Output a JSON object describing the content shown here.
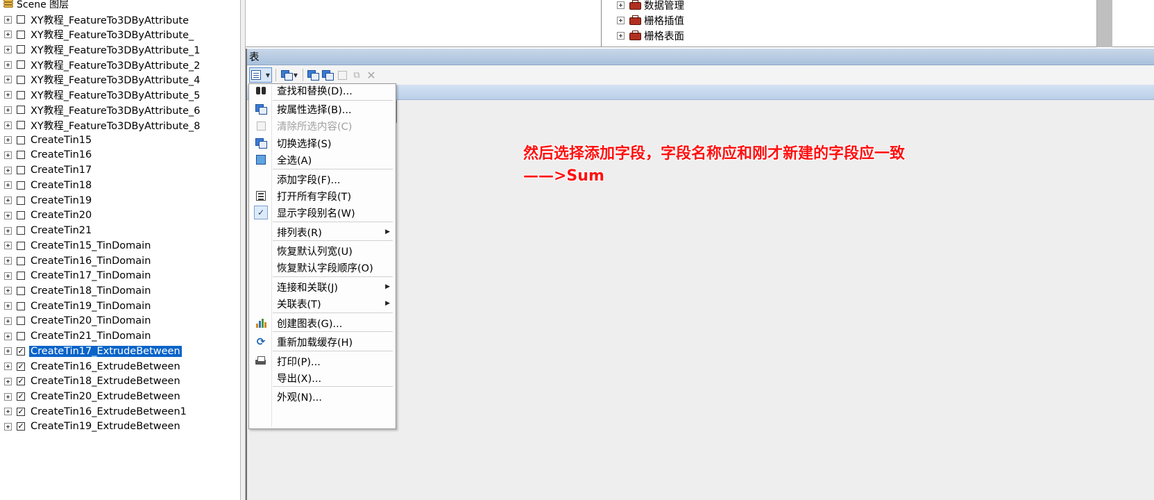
{
  "layer_tree": {
    "header": "Scene 图层",
    "items": [
      {
        "label": "XY教程_FeatureTo3DByAttribute",
        "checked": false,
        "selected": false
      },
      {
        "label": "XY教程_FeatureTo3DByAttribute_",
        "checked": false,
        "selected": false
      },
      {
        "label": "XY教程_FeatureTo3DByAttribute_1",
        "checked": false,
        "selected": false
      },
      {
        "label": "XY教程_FeatureTo3DByAttribute_2",
        "checked": false,
        "selected": false
      },
      {
        "label": "XY教程_FeatureTo3DByAttribute_4",
        "checked": false,
        "selected": false
      },
      {
        "label": "XY教程_FeatureTo3DByAttribute_5",
        "checked": false,
        "selected": false
      },
      {
        "label": "XY教程_FeatureTo3DByAttribute_6",
        "checked": false,
        "selected": false
      },
      {
        "label": "XY教程_FeatureTo3DByAttribute_8",
        "checked": false,
        "selected": false
      },
      {
        "label": "CreateTin15",
        "checked": false,
        "selected": false
      },
      {
        "label": "CreateTin16",
        "checked": false,
        "selected": false
      },
      {
        "label": "CreateTin17",
        "checked": false,
        "selected": false
      },
      {
        "label": "CreateTin18",
        "checked": false,
        "selected": false
      },
      {
        "label": "CreateTin19",
        "checked": false,
        "selected": false
      },
      {
        "label": "CreateTin20",
        "checked": false,
        "selected": false
      },
      {
        "label": "CreateTin21",
        "checked": false,
        "selected": false
      },
      {
        "label": "CreateTin15_TinDomain",
        "checked": false,
        "selected": false
      },
      {
        "label": "CreateTin16_TinDomain",
        "checked": false,
        "selected": false
      },
      {
        "label": "CreateTin17_TinDomain",
        "checked": false,
        "selected": false
      },
      {
        "label": "CreateTin18_TinDomain",
        "checked": false,
        "selected": false
      },
      {
        "label": "CreateTin19_TinDomain",
        "checked": false,
        "selected": false
      },
      {
        "label": "CreateTin20_TinDomain",
        "checked": false,
        "selected": false
      },
      {
        "label": "CreateTin21_TinDomain",
        "checked": false,
        "selected": false
      },
      {
        "label": "CreateTin17_ExtrudeBetween",
        "checked": true,
        "selected": true
      },
      {
        "label": "CreateTin16_ExtrudeBetween",
        "checked": true,
        "selected": false
      },
      {
        "label": "CreateTin18_ExtrudeBetween",
        "checked": true,
        "selected": false
      },
      {
        "label": "CreateTin20_ExtrudeBetween",
        "checked": true,
        "selected": false
      },
      {
        "label": "CreateTin16_ExtrudeBetween1",
        "checked": true,
        "selected": false
      },
      {
        "label": "CreateTin19_ExtrudeBetween",
        "checked": true,
        "selected": false
      }
    ]
  },
  "catalog": {
    "items": [
      {
        "label": "数据管理"
      },
      {
        "label": "栅格插值"
      },
      {
        "label": "栅格表面"
      }
    ]
  },
  "table_window": {
    "title": "表"
  },
  "menu": {
    "items": [
      {
        "label": "查找和替换(D)...",
        "icon": "binoculars-icon",
        "disabled": false,
        "submenu": false
      },
      {
        "label": "按属性选择(B)...",
        "icon": "select-by-attributes-icon",
        "disabled": false,
        "submenu": false
      },
      {
        "label": "清除所选内容(C)",
        "icon": "clear-selection-icon",
        "disabled": true,
        "submenu": false
      },
      {
        "label": "切换选择(S)",
        "icon": "switch-selection-icon",
        "disabled": false,
        "submenu": false
      },
      {
        "label": "全选(A)",
        "icon": "select-all-icon",
        "disabled": false,
        "submenu": false
      },
      {
        "label": "添加字段(F)...",
        "icon": "",
        "disabled": false,
        "submenu": false
      },
      {
        "label": "打开所有字段(T)",
        "icon": "fields-icon",
        "disabled": false,
        "submenu": false
      },
      {
        "label": "显示字段别名(W)",
        "icon": "check-icon",
        "disabled": false,
        "submenu": false
      },
      {
        "label": "排列表(R)",
        "icon": "",
        "disabled": false,
        "submenu": true
      },
      {
        "label": "恢复默认列宽(U)",
        "icon": "",
        "disabled": false,
        "submenu": false
      },
      {
        "label": "恢复默认字段顺序(O)",
        "icon": "",
        "disabled": false,
        "submenu": false
      },
      {
        "label": "连接和关联(J)",
        "icon": "",
        "disabled": false,
        "submenu": true
      },
      {
        "label": "关联表(T)",
        "icon": "",
        "disabled": false,
        "submenu": true
      },
      {
        "label": "创建图表(G)...",
        "icon": "bar-chart-icon",
        "disabled": false,
        "submenu": false
      },
      {
        "label": "重新加载缓存(H)",
        "icon": "refresh-icon",
        "disabled": false,
        "submenu": false
      },
      {
        "label": "打印(P)...",
        "icon": "printer-icon",
        "disabled": false,
        "submenu": false
      },
      {
        "label": "导出(X)...",
        "icon": "",
        "disabled": false,
        "submenu": false
      },
      {
        "label": "外观(N)...",
        "icon": "",
        "disabled": false,
        "submenu": false
      }
    ]
  },
  "annotation": {
    "line1": "然后选择添加字段，字段名称应和刚才新建的字段应一致",
    "line2": "——>Sum",
    "color": "#ff1010"
  },
  "colors": {
    "selection": "#0a64c8",
    "titlebar": "#b5cbe3"
  }
}
